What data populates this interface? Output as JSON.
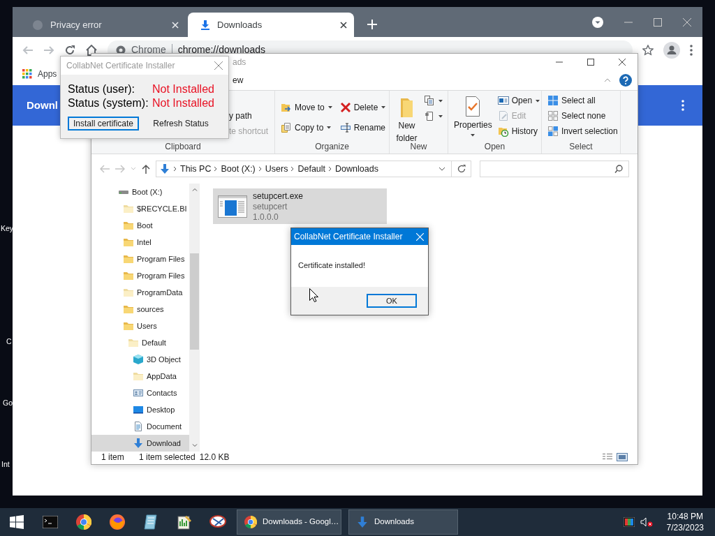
{
  "desktop_icons": [
    {
      "label": "Key"
    },
    {
      "label": "C"
    },
    {
      "label": "Go"
    },
    {
      "label": "Int"
    }
  ],
  "browser": {
    "tabs": [
      {
        "label": "Privacy error",
        "selected": false
      },
      {
        "label": "Downloads",
        "selected": true
      }
    ],
    "omnibox": {
      "site_label": "Chrome",
      "url": "chrome://downloads"
    },
    "bookmarks": [
      {
        "label": "Apps"
      }
    ],
    "page_title": "Downl"
  },
  "explorer": {
    "title": "ads",
    "ribbon_tabs": [
      {
        "label": "ew"
      }
    ],
    "ribbon_groups": [
      {
        "label": "Clipboard",
        "commands": [
          {
            "kind": "text",
            "label": "y path",
            "disabled": false,
            "dropdown": false
          },
          {
            "kind": "text",
            "label": "te shortcut",
            "disabled": true,
            "dropdown": false
          }
        ]
      },
      {
        "label": "Organize",
        "commands": [
          {
            "kind": "small",
            "label": "Move to",
            "disabled": false,
            "dropdown": true
          },
          {
            "kind": "small",
            "label": "Copy to",
            "disabled": false,
            "dropdown": true
          },
          {
            "kind": "small",
            "label": "Delete",
            "disabled": false,
            "dropdown": true
          },
          {
            "kind": "small",
            "label": "Rename",
            "disabled": false,
            "dropdown": false
          }
        ]
      },
      {
        "label": "New",
        "commands": [
          {
            "kind": "large",
            "label": "New folder",
            "disabled": false,
            "dropdown": false
          },
          {
            "kind": "icon",
            "disabled": false,
            "dropdown": true
          },
          {
            "kind": "icon",
            "disabled": false,
            "dropdown": true
          }
        ]
      },
      {
        "label": "Open",
        "commands": [
          {
            "kind": "large",
            "label": "Properties",
            "disabled": false,
            "dropdown": true
          },
          {
            "kind": "small",
            "label": "Open",
            "disabled": false,
            "dropdown": true
          },
          {
            "kind": "small",
            "label": "Edit",
            "disabled": true,
            "dropdown": false
          },
          {
            "kind": "small",
            "label": "History",
            "disabled": false,
            "dropdown": false
          }
        ]
      },
      {
        "label": "Select",
        "commands": [
          {
            "kind": "small",
            "label": "Select all",
            "disabled": false,
            "dropdown": false
          },
          {
            "kind": "small",
            "label": "Select none",
            "disabled": false,
            "dropdown": false
          },
          {
            "kind": "small",
            "label": "Invert selection",
            "disabled": false,
            "dropdown": false
          }
        ]
      }
    ],
    "breadcrumbs": [
      "This PC",
      "Boot (X:)",
      "Users",
      "Default",
      "Downloads"
    ],
    "nav_tree": [
      {
        "label": "Boot (X:)",
        "selected": false,
        "children": [
          {
            "label": "$RECYCLE.BI",
            "selected": false
          },
          {
            "label": "Boot",
            "selected": false
          },
          {
            "label": "Intel",
            "selected": false
          },
          {
            "label": "Program Files",
            "selected": false
          },
          {
            "label": "Program Files",
            "selected": false
          },
          {
            "label": "ProgramData",
            "selected": false
          },
          {
            "label": "sources",
            "selected": false
          },
          {
            "label": "Users",
            "selected": false,
            "children": [
              {
                "label": "Default",
                "selected": false,
                "children": [
                  {
                    "label": "3D Object",
                    "selected": false
                  },
                  {
                    "label": "AppData",
                    "selected": false
                  },
                  {
                    "label": "Contacts",
                    "selected": false
                  },
                  {
                    "label": "Desktop",
                    "selected": false
                  },
                  {
                    "label": "Document",
                    "selected": false
                  },
                  {
                    "label": "Download",
                    "selected": true
                  }
                ]
              }
            ]
          }
        ]
      }
    ],
    "files": [
      {
        "name": "setupcert.exe",
        "description": "setupcert",
        "version": "1.0.0.0",
        "selected": true
      }
    ],
    "status_bar": [
      "1 item",
      "1 item selected",
      "12.0 KB"
    ]
  },
  "installer": {
    "title": "CollabNet Certificate Installer",
    "rows": [
      {
        "label": "Status (user):",
        "value": "Not Installed"
      },
      {
        "label": "Status (system):",
        "value": "Not Installed"
      }
    ],
    "buttons": [
      {
        "label": "Install certificate",
        "focused": true
      },
      {
        "label": "Refresh Status",
        "focused": false
      }
    ]
  },
  "message_box": {
    "title": "CollabNet Certificate Installer",
    "message": "Certificate installed!",
    "buttons": [
      {
        "label": "OK",
        "focused": true
      }
    ]
  },
  "taskbar": {
    "tasks": [
      {
        "label": "Downloads - Googl…"
      },
      {
        "label": "Downloads"
      }
    ],
    "time": "10:48 PM",
    "date": "7/23/2023"
  }
}
